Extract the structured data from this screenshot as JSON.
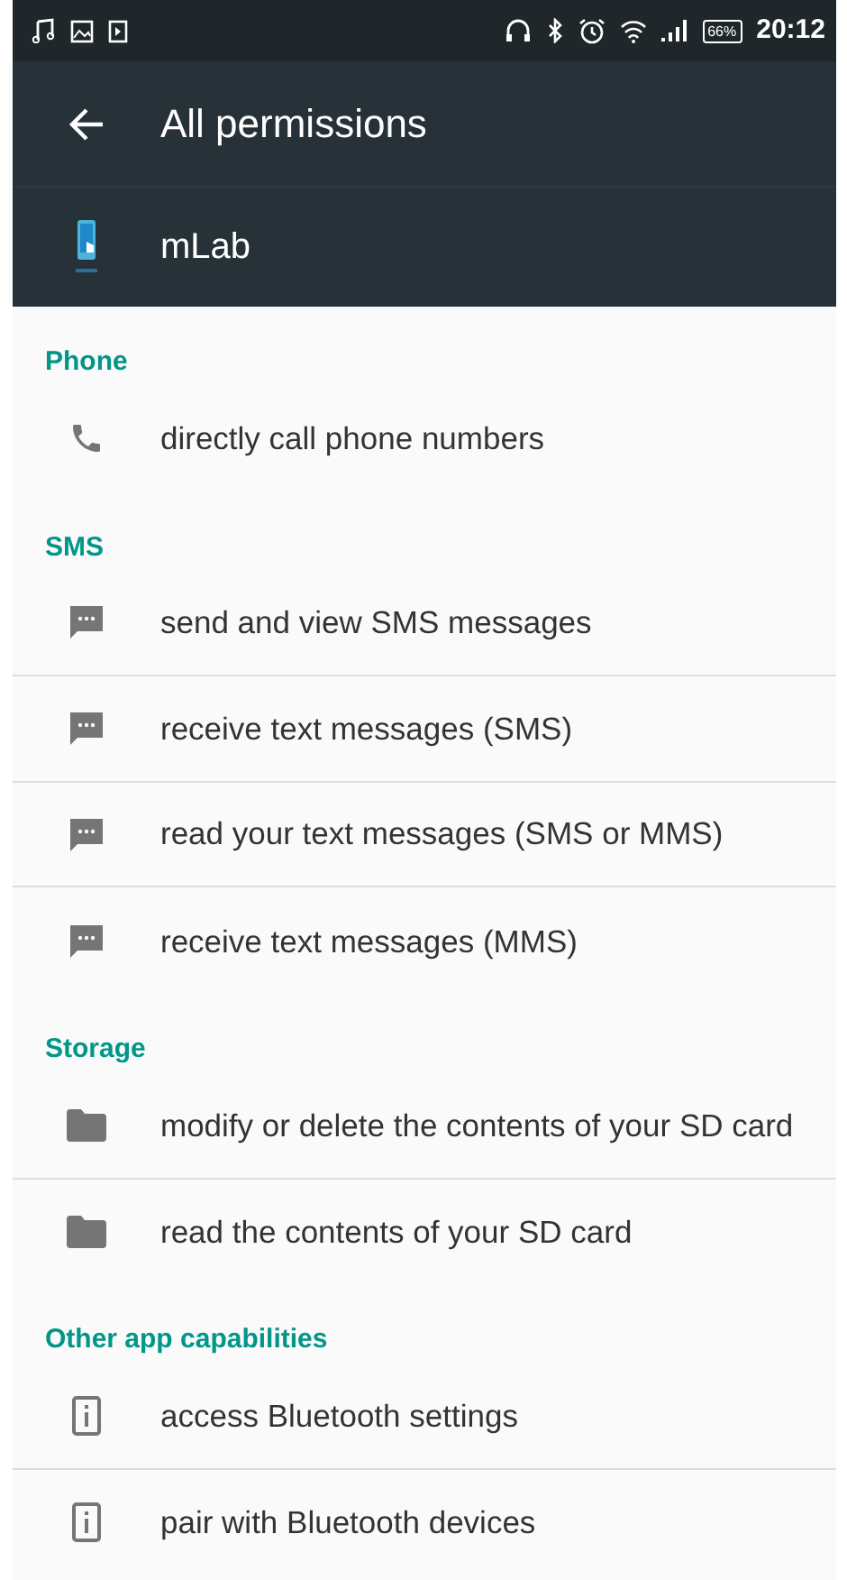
{
  "status_bar": {
    "battery": "66%",
    "time": "20:12"
  },
  "toolbar": {
    "title": "All permissions"
  },
  "app": {
    "name": "mLab"
  },
  "groups": [
    {
      "title": "Phone",
      "items": [
        {
          "kind": "phone",
          "label": "directly call phone numbers"
        }
      ]
    },
    {
      "title": "SMS",
      "items": [
        {
          "kind": "message",
          "label": "send and view SMS messages"
        },
        {
          "kind": "message",
          "label": "receive text messages (SMS)"
        },
        {
          "kind": "message",
          "label": "read your text messages (SMS or MMS)"
        },
        {
          "kind": "message",
          "label": "receive text messages (MMS)"
        }
      ]
    },
    {
      "title": "Storage",
      "items": [
        {
          "kind": "folder",
          "label": "modify or delete the contents of your SD card"
        },
        {
          "kind": "folder",
          "label": "read the contents of your SD card"
        }
      ]
    },
    {
      "title": "Other app capabilities",
      "items": [
        {
          "kind": "info",
          "label": "access Bluetooth settings"
        },
        {
          "kind": "info",
          "label": "pair with Bluetooth devices"
        }
      ]
    }
  ]
}
